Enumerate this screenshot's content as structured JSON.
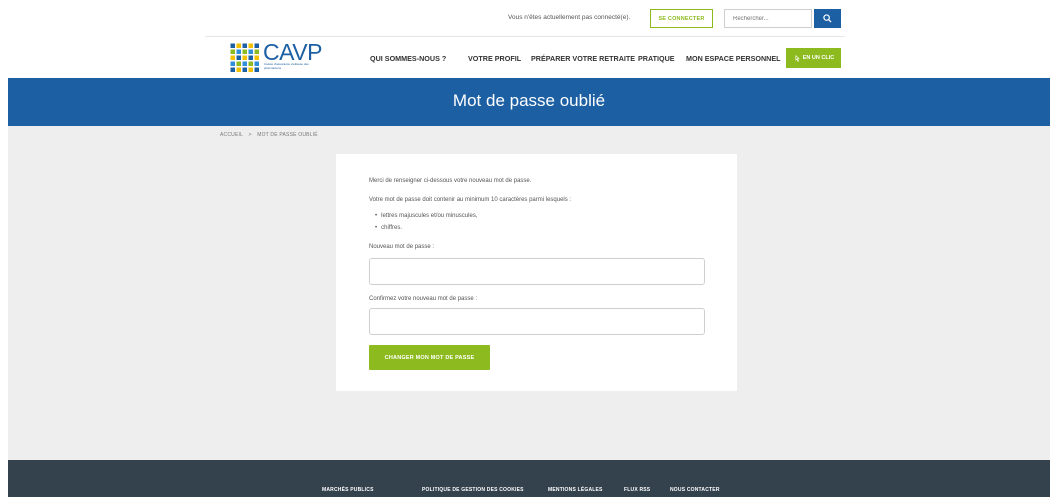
{
  "topbar": {
    "status_text": "Vous n'êtes actuellement pas connecté(e).",
    "login_label": "SE CONNECTER",
    "search_placeholder": "Rechercher...",
    "search_icon": "search-icon"
  },
  "brand": {
    "logo_text": "CAVP",
    "logo_subtext": "Caisse d'assurance vieillesse des pharmaciens",
    "primary_color": "#1c5fa3",
    "accent_color": "#8dbb1f"
  },
  "nav": {
    "items": [
      {
        "label": "QUI SOMMES-NOUS ?"
      },
      {
        "label": "VOTRE PROFIL"
      },
      {
        "label": "PRÉPARER VOTRE RETRAITE"
      },
      {
        "label": "PRATIQUE"
      },
      {
        "label": "MON ESPACE PERSONNEL"
      }
    ],
    "clic_label": "EN UN CLIC",
    "clic_icon": "click-icon"
  },
  "banner": {
    "title": "Mot de passe oublié"
  },
  "breadcrumb": {
    "home": "ACCUEIL",
    "separator": ">",
    "current": "MOT DE PASSE OUBLIÉ"
  },
  "form": {
    "intro": "Merci de renseigner ci-dessous votre nouveau mot de passe.",
    "rules_intro": "Votre mot de passe doit contenir au minimum 10 caractères parmi lesquels :",
    "rules": [
      "lettres majuscules et/ou minuscules,",
      "chiffres."
    ],
    "new_label": "Nouveau mot de passe :",
    "new_value": "",
    "confirm_label": "Confirmez votre nouveau mot de passe :",
    "confirm_value": "",
    "submit_label": "CHANGER MON MOT DE PASSE"
  },
  "footer": {
    "links": [
      {
        "label": "MARCHÉS PUBLICS"
      },
      {
        "label": "POLITIQUE DE GESTION DES COOKIES"
      },
      {
        "label": "MENTIONS LÉGALES"
      },
      {
        "label": "FLUX RSS"
      },
      {
        "label": "NOUS CONTACTER"
      }
    ],
    "background": "#34424e"
  }
}
